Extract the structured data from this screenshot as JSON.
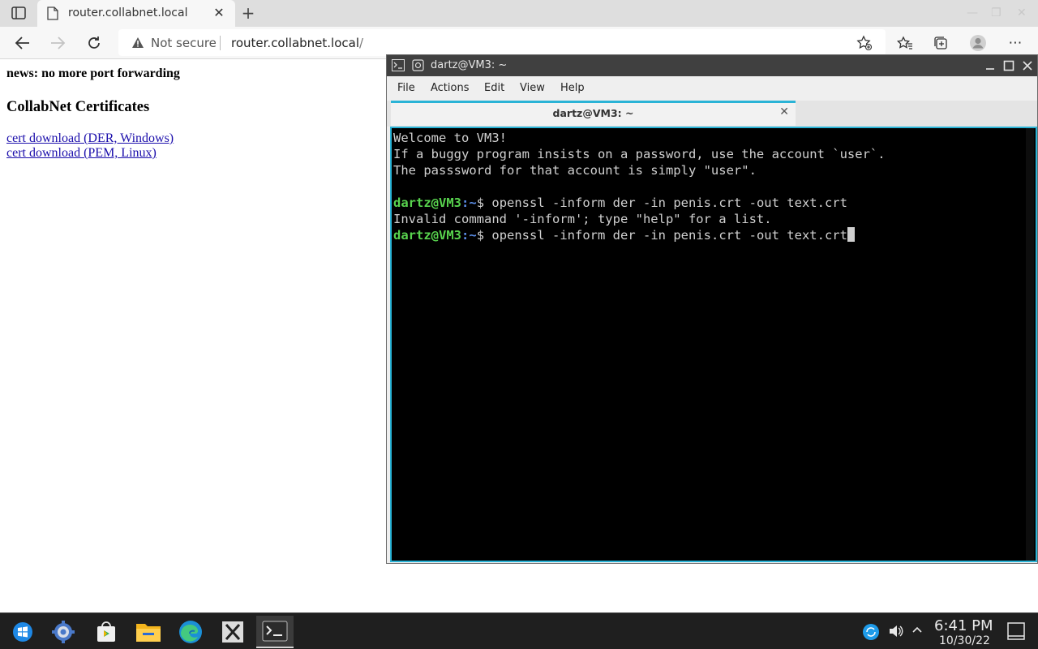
{
  "browser": {
    "tab_title": "router.collabnet.local",
    "security_label": "Not secure",
    "url_host": "router.collabnet.local",
    "url_path": "/"
  },
  "page": {
    "news": "news: no more port forwarding",
    "heading": "CollabNet Certificates",
    "links": [
      "cert download (DER, Windows)",
      "cert download (PEM, Linux)"
    ]
  },
  "terminal": {
    "window_title": "dartz@VM3: ~",
    "menu": [
      "File",
      "Actions",
      "Edit",
      "View",
      "Help"
    ],
    "tab_title": "dartz@VM3: ~",
    "lines": [
      "Welcome to VM3!",
      "If a buggy program insists on a password, use the account `user`.",
      "The passsword for that account is simply \"user\".",
      "",
      "Invalid command '-inform'; type \"help\" for a list."
    ],
    "prompt_user": "dartz@VM3",
    "prompt_sep": ":",
    "prompt_path": "~",
    "prompt_dollar": "$ ",
    "cmd1": "openssl -inform der -in penis.crt -out text.crt",
    "cmd2": "openssl -inform der -in penis.crt -out text.crt"
  },
  "taskbar": {
    "time": "6:41 PM",
    "date": "10/30/22"
  },
  "colors": {
    "accent": "#2ab3d6",
    "prompt_user": "#58d34e",
    "prompt_path": "#5b8de6"
  }
}
